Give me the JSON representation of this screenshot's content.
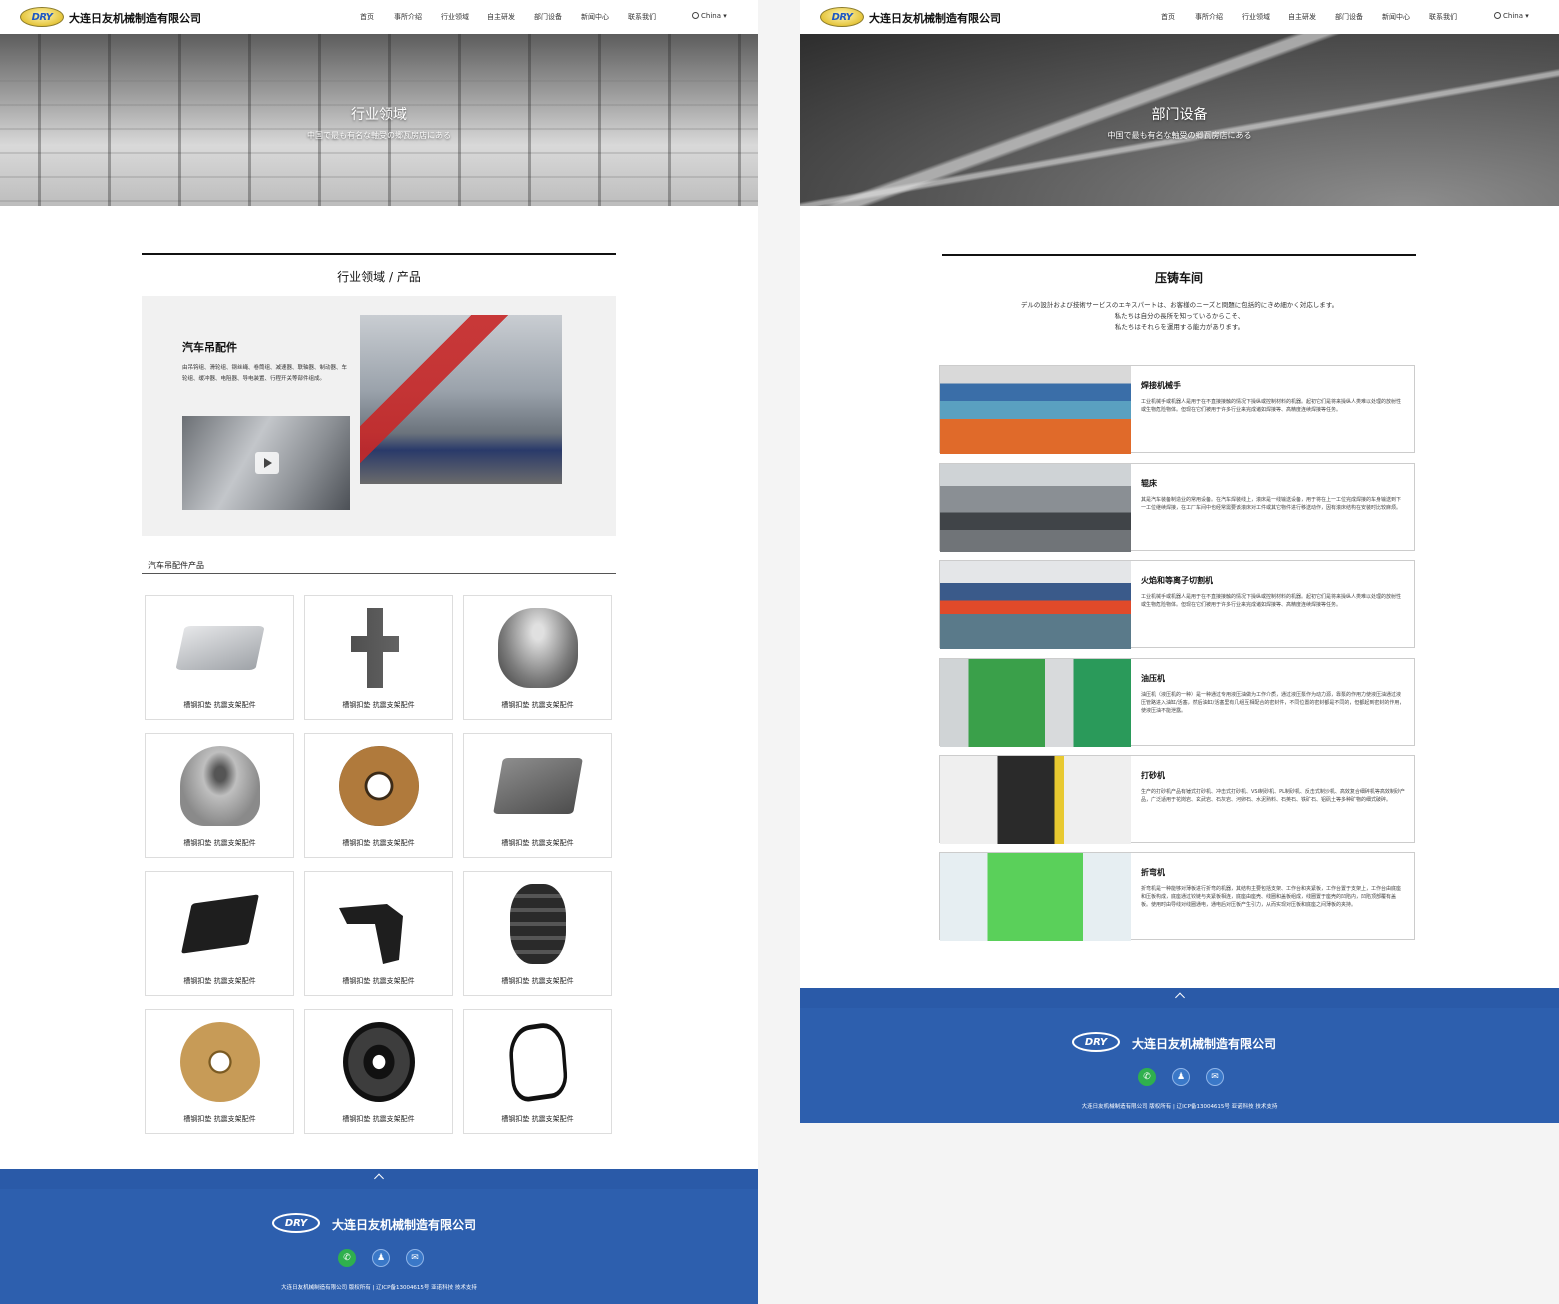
{
  "header": {
    "logo_text": "DRY",
    "brand": "大连日友机械制造有限公司",
    "nav": [
      "首页",
      "事所介绍",
      "行业领域",
      "自主研发",
      "部门设备",
      "新闻中心",
      "联系我们"
    ],
    "lang": "China ▾"
  },
  "left_page": {
    "hero": {
      "title": "行业领域",
      "subtitle": "中国で最も有名な軸受の郷瓦房店にある"
    },
    "section_title": "行业领域 / 产品",
    "feature": {
      "title": "汽车吊配件",
      "desc": "由吊钩组、滑轮组、钢丝绳、卷筒组、减速器、联轴器、制动器、车轮组、缓冲器、电阻器、导电装置、行程开关等部件组成。"
    },
    "products_heading": "汽车吊配件产品",
    "products": [
      {
        "label": "槽钢扣垫 抗震支架配件",
        "icon": "plate"
      },
      {
        "label": "槽钢扣垫 抗震支架配件",
        "icon": "t-bracket"
      },
      {
        "label": "槽钢扣垫 抗震支架配件",
        "icon": "cylinder"
      },
      {
        "label": "槽钢扣垫 抗震支架配件",
        "icon": "cup"
      },
      {
        "label": "槽钢扣垫 抗震支架配件",
        "icon": "ring-brown"
      },
      {
        "label": "槽钢扣垫 抗震支架配件",
        "icon": "block"
      },
      {
        "label": "槽钢扣垫 抗震支架配件",
        "icon": "pad"
      },
      {
        "label": "槽钢扣垫 抗震支架配件",
        "icon": "bracket"
      },
      {
        "label": "槽钢扣垫 抗震支架配件",
        "icon": "stack"
      },
      {
        "label": "槽钢扣垫 抗震支架配件",
        "icon": "ring-gold"
      },
      {
        "label": "槽钢扣垫 抗震支架配件",
        "icon": "pulley"
      },
      {
        "label": "槽钢扣垫 抗震支架配件",
        "icon": "holder"
      }
    ]
  },
  "right_page": {
    "hero": {
      "title": "部门设备",
      "subtitle": "中国で最も有名な軸受の郷瓦房店にある"
    },
    "section_title": "压铸车间",
    "intro": [
      "デルの設計および技術サービスのエキスパートは、お客様のニーズと問題に包括的にきめ細かく対応します。",
      "私たちは自分の長所を知っているからこそ、",
      "私たちはそれらを運用する能力があります。"
    ],
    "equipment": [
      {
        "title": "焊接机械手",
        "desc": "工业机械手或机器人是用于在不直接接触的情况下操纵或控制材料的机器。起初它们是将来操纵人类难以处理的放射性或生物危险物体。但现在它们被用于许多行业来完成诸如焊接等、高精度连续焊接等任务。"
      },
      {
        "title": "辊床",
        "desc": "其是汽车装备制造业的常用设备。在汽车焊装线上，滚床是一线输送设备，用于将在上一工位完成焊接的车身输送到下一工位继续焊接，在工厂车间中也经常需要该滚床对工件或其它物件进行移送动作，因有滚床结构在安装时比较麻烦。"
      },
      {
        "title": "火焰和等离子切割机",
        "desc": "工业机械手或机器人是用于在不直接接触的情况下操纵或控制材料的机器。起初它们是将来操纵人类难以处理的放射性或生物危险物体。但现在它们被用于许多行业来完成诸如焊接等、高精度连续焊接等任务。"
      },
      {
        "title": "油压机",
        "desc": "油压机（液压机的一种）是一种通过专用液压油做为工作介质，通过液压泵作为动力源，靠泵的作用力使液压油通过液压管路进入油缸/活塞，然后油缸/活塞里有几组互相配合的密封件，不同位置的密封都是不同的，但都起到密封的作用，使液压油不能泄露。"
      },
      {
        "title": "打砂机",
        "desc": "生产的打砂机产品有锤式打砂机、冲击式打砂机、VSI制砂机、PL制砂机、反击式制沙机、高效复合细碎机等高效制砂产品，广泛适用于花岗岩、玄武岩、石灰岩、河卵石、水泥熟料、石英石、铁矿石、铝矾土等多种矿物的细式破碎。"
      },
      {
        "title": "折弯机",
        "desc": "折弯机是一种能够对薄板进行折弯的机器，其结构主要包括支架、工作台和夹紧板，工作台置于支架上，工作台由底座和压板构成，底座通过铰链与夹紧板相连，底座由座壳、线圈和盖板组成，线圈置于座壳的凹陷内，凹陷顶部覆有盖板。使用时由导线对线圈通电，通电后对压板产生引力，从而实现对压板和底座之间薄板的夹持。"
      }
    ]
  },
  "footer": {
    "logo_text": "DRY",
    "brand": "大连日友机械制造有限公司",
    "icons": [
      "wechat-icon",
      "qq-icon",
      "mail-icon"
    ],
    "copyright": "大连日友机械制造有限公司 版权所有 | 辽ICP备13004615号  亚诺科技 技术支持"
  }
}
